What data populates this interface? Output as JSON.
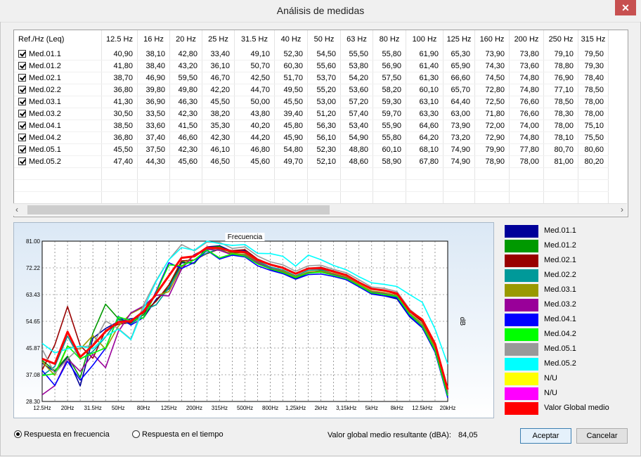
{
  "window": {
    "title": "Análisis de medidas",
    "close": "✕"
  },
  "table": {
    "headers": [
      "Ref./Hz (Leq)",
      "12.5 Hz",
      "16 Hz",
      "20 Hz",
      "25 Hz",
      "31.5 Hz",
      "40 Hz",
      "50 Hz",
      "63 Hz",
      "80 Hz",
      "100 Hz",
      "125 Hz",
      "160 Hz",
      "200 Hz",
      "250 Hz",
      "315 Hz"
    ],
    "rows": [
      {
        "ref": "Med.01.1",
        "values": [
          "40,90",
          "38,10",
          "42,80",
          "33,40",
          "49,10",
          "52,30",
          "54,50",
          "55,50",
          "55,80",
          "61,90",
          "65,30",
          "73,90",
          "73,80",
          "79,10",
          "79,50"
        ]
      },
      {
        "ref": "Med.01.2",
        "values": [
          "41,80",
          "38,40",
          "43,20",
          "36,10",
          "50,70",
          "60,30",
          "55,60",
          "53,80",
          "56,90",
          "61,40",
          "65,90",
          "74,30",
          "73,60",
          "78,80",
          "79,30"
        ]
      },
      {
        "ref": "Med.02.1",
        "values": [
          "38,70",
          "46,90",
          "59,50",
          "46,70",
          "42,50",
          "51,70",
          "53,70",
          "54,20",
          "57,50",
          "61,30",
          "66,60",
          "74,50",
          "74,80",
          "76,90",
          "78,40"
        ]
      },
      {
        "ref": "Med.02.2",
        "values": [
          "36,80",
          "39,80",
          "49,80",
          "42,20",
          "44,70",
          "49,50",
          "55,20",
          "53,60",
          "58,20",
          "60,10",
          "65,70",
          "72,80",
          "74,80",
          "77,10",
          "78,50"
        ]
      },
      {
        "ref": "Med.03.1",
        "values": [
          "41,30",
          "36,90",
          "46,30",
          "45,50",
          "50,00",
          "45,50",
          "53,00",
          "57,20",
          "59,30",
          "63,10",
          "64,40",
          "72,50",
          "76,60",
          "78,50",
          "78,00"
        ]
      },
      {
        "ref": "Med.03.2",
        "values": [
          "30,50",
          "33,50",
          "42,30",
          "38,20",
          "43,80",
          "39,40",
          "51,20",
          "57,40",
          "59,70",
          "63,30",
          "63,00",
          "71,80",
          "76,60",
          "78,30",
          "78,00"
        ]
      },
      {
        "ref": "Med.04.1",
        "values": [
          "38,50",
          "33,60",
          "41,50",
          "35,30",
          "40,20",
          "45,80",
          "56,30",
          "53,40",
          "55,90",
          "64,60",
          "73,90",
          "72,00",
          "74,00",
          "78,00",
          "75,10"
        ]
      },
      {
        "ref": "Med.04.2",
        "values": [
          "36,80",
          "37,40",
          "46,60",
          "42,30",
          "44,20",
          "45,90",
          "56,10",
          "54,90",
          "55,80",
          "64,20",
          "73,20",
          "72,90",
          "74,80",
          "78,10",
          "75,50"
        ]
      },
      {
        "ref": "Med.05.1",
        "values": [
          "45,50",
          "37,50",
          "42,30",
          "46,10",
          "46,80",
          "54,80",
          "52,30",
          "48,80",
          "60,10",
          "68,10",
          "74,90",
          "79,90",
          "77,80",
          "80,70",
          "80,60"
        ]
      },
      {
        "ref": "Med.05.2",
        "values": [
          "47,40",
          "44,30",
          "45,60",
          "46,50",
          "45,60",
          "49,70",
          "52,10",
          "48,60",
          "58,90",
          "67,80",
          "74,90",
          "78,90",
          "78,00",
          "81,00",
          "80,20"
        ]
      }
    ]
  },
  "chart_data": {
    "type": "line",
    "title": "Frecuencia",
    "ylabel": "dB",
    "ylim": [
      28.3,
      81.0
    ],
    "y_ticks": [
      "81.00",
      "72.22",
      "63.43",
      "54.65",
      "45.87",
      "37.08",
      "28.30"
    ],
    "x_tick_labels": [
      "12.5Hz",
      "20Hz",
      "31.5Hz",
      "50Hz",
      "80Hz",
      "125Hz",
      "200Hz",
      "315Hz",
      "500Hz",
      "800Hz",
      "1,25kHz",
      "2kHz",
      "3,15kHz",
      "5kHz",
      "8kHz",
      "12.5kHz",
      "20kHz"
    ],
    "x": [
      "12.5",
      "16",
      "20",
      "25",
      "31.5",
      "40",
      "50",
      "63",
      "80",
      "100",
      "125",
      "160",
      "200",
      "250",
      "315",
      "400",
      "500",
      "630",
      "800",
      "1k",
      "1.25k",
      "1.6k",
      "2k",
      "2.5k",
      "3.15k",
      "4k",
      "5k",
      "6.3k",
      "8k",
      "10k",
      "12.5k",
      "16k",
      "20k"
    ],
    "series": [
      {
        "name": "Med.01.1",
        "color": "#000099",
        "values": [
          40.9,
          38.1,
          42.8,
          33.4,
          49.1,
          52.3,
          54.5,
          55.5,
          55.8,
          61.9,
          65.3,
          73.9,
          73.8,
          79.1,
          79.5,
          77.6,
          77.8,
          74.0,
          71.8,
          70.6,
          68.6,
          70.5,
          71.2,
          69.9,
          68.8,
          66.1,
          63.8,
          63.0,
          62.0,
          56.1,
          52.5,
          44.5,
          30.1
        ]
      },
      {
        "name": "Med.01.2",
        "color": "#009900",
        "values": [
          41.8,
          38.4,
          43.2,
          36.1,
          50.7,
          60.3,
          55.6,
          53.8,
          56.9,
          61.4,
          65.9,
          74.3,
          73.6,
          78.8,
          79.3,
          77.0,
          77.5,
          73.8,
          72.0,
          70.9,
          68.9,
          70.7,
          71.3,
          70.1,
          68.9,
          66.3,
          64.2,
          63.4,
          62.3,
          56.8,
          53.0,
          45.0,
          30.5
        ]
      },
      {
        "name": "Med.02.1",
        "color": "#990000",
        "values": [
          38.7,
          46.9,
          59.5,
          46.7,
          42.5,
          51.7,
          53.7,
          54.2,
          57.5,
          61.3,
          66.6,
          74.5,
          74.8,
          76.9,
          78.4,
          77.9,
          78.2,
          75.1,
          73.4,
          72.4,
          70.4,
          72.1,
          72.4,
          71.2,
          70.0,
          67.5,
          65.3,
          64.7,
          63.5,
          57.8,
          54.5,
          46.0,
          31.0
        ]
      },
      {
        "name": "Med.02.2",
        "color": "#009999",
        "values": [
          36.8,
          39.8,
          49.8,
          42.2,
          44.7,
          49.5,
          55.2,
          53.6,
          58.2,
          60.1,
          65.7,
          72.8,
          74.8,
          77.1,
          78.5,
          76.5,
          76.8,
          74.4,
          72.5,
          71.5,
          69.6,
          71.4,
          71.6,
          70.3,
          69.0,
          66.6,
          64.5,
          63.6,
          62.6,
          56.7,
          53.0,
          45.5,
          30.8
        ]
      },
      {
        "name": "Med.03.1",
        "color": "#999900",
        "values": [
          41.3,
          36.9,
          46.3,
          45.5,
          50.0,
          45.5,
          53.0,
          57.2,
          59.3,
          63.1,
          64.4,
          72.5,
          76.6,
          78.5,
          78.0,
          76.9,
          76.7,
          74.1,
          72.0,
          71.2,
          69.3,
          70.9,
          71.1,
          70.4,
          69.2,
          66.8,
          64.6,
          64.1,
          63.1,
          57.2,
          53.9,
          46.0,
          31.5
        ]
      },
      {
        "name": "Med.03.2",
        "color": "#990099",
        "values": [
          30.5,
          33.5,
          42.3,
          38.2,
          43.8,
          39.4,
          51.2,
          57.4,
          59.7,
          63.3,
          63.0,
          71.8,
          76.6,
          78.3,
          78.0,
          76.5,
          76.3,
          73.9,
          72.1,
          70.8,
          69.0,
          70.6,
          70.8,
          70.0,
          68.9,
          66.4,
          64.1,
          63.7,
          62.8,
          56.9,
          53.3,
          45.2,
          30.9
        ]
      },
      {
        "name": "Med.04.1",
        "color": "#0000ff",
        "values": [
          38.5,
          33.6,
          41.5,
          35.3,
          40.2,
          45.8,
          56.3,
          53.4,
          55.9,
          64.6,
          73.9,
          72.0,
          74.0,
          78.0,
          75.1,
          76.4,
          75.8,
          72.9,
          71.4,
          70.3,
          68.5,
          70.0,
          70.2,
          69.4,
          68.3,
          66.0,
          63.6,
          63.0,
          62.4,
          56.3,
          52.6,
          44.7,
          29.5
        ]
      },
      {
        "name": "Med.04.2",
        "color": "#00ff00",
        "values": [
          36.8,
          37.4,
          46.6,
          42.3,
          44.2,
          45.9,
          56.1,
          54.9,
          55.8,
          64.2,
          73.2,
          72.9,
          74.8,
          78.1,
          75.5,
          76.8,
          76.1,
          73.5,
          71.9,
          70.7,
          69.0,
          70.5,
          70.8,
          69.8,
          68.7,
          66.4,
          64.0,
          63.5,
          62.8,
          56.9,
          53.1,
          45.1,
          30.2
        ]
      },
      {
        "name": "Med.05.1",
        "color": "#999999",
        "values": [
          45.5,
          37.5,
          42.3,
          46.1,
          46.8,
          54.8,
          52.3,
          48.8,
          60.1,
          68.1,
          74.9,
          79.9,
          77.8,
          80.7,
          80.6,
          78.6,
          79.1,
          76.1,
          74.2,
          73.2,
          71.1,
          72.9,
          73.1,
          71.7,
          70.6,
          68.3,
          65.9,
          65.5,
          64.4,
          58.6,
          55.1,
          47.1,
          32.0
        ]
      },
      {
        "name": "Med.05.2",
        "color": "#00ffff",
        "values": [
          47.4,
          44.3,
          45.6,
          46.5,
          45.6,
          49.7,
          52.1,
          48.6,
          58.9,
          67.8,
          74.9,
          78.9,
          78.0,
          81.0,
          80.2,
          79.6,
          79.9,
          77.0,
          76.9,
          76.0,
          72.8,
          76.4,
          74.9,
          73.0,
          71.6,
          69.3,
          67.3,
          66.8,
          66.1,
          63.4,
          60.9,
          52.1,
          40.6
        ]
      },
      {
        "name": "Valor Global medio",
        "color": "#ff0000",
        "values": [
          42.3,
          40.7,
          51.2,
          42.9,
          46.7,
          51.3,
          54.4,
          54.7,
          57.9,
          63.7,
          69.6,
          75.5,
          76.0,
          78.9,
          78.7,
          77.6,
          77.4,
          74.8,
          73.3,
          72.2,
          70.3,
          72.0,
          72.1,
          71.0,
          69.8,
          67.4,
          65.3,
          64.8,
          63.8,
          58.1,
          55.2,
          47.2,
          32.2
        ]
      }
    ],
    "legend": [
      {
        "label": "Med.01.1",
        "color": "#000099"
      },
      {
        "label": "Med.01.2",
        "color": "#009900"
      },
      {
        "label": "Med.02.1",
        "color": "#990000"
      },
      {
        "label": "Med.02.2",
        "color": "#009999"
      },
      {
        "label": "Med.03.1",
        "color": "#999900"
      },
      {
        "label": "Med.03.2",
        "color": "#990099"
      },
      {
        "label": "Med.04.1",
        "color": "#0000ff"
      },
      {
        "label": "Med.04.2",
        "color": "#00ff00"
      },
      {
        "label": "Med.05.1",
        "color": "#999999"
      },
      {
        "label": "Med.05.2",
        "color": "#00ffff"
      },
      {
        "label": "N/U",
        "color": "#ffff00"
      },
      {
        "label": "N/U",
        "color": "#ff00ff"
      },
      {
        "label": "Valor Global medio",
        "color": "#ff0000"
      }
    ]
  },
  "controls": {
    "radio_freq": "Respuesta en frecuencia",
    "radio_time": "Respuesta en el tiempo",
    "global_label": "Valor global medio resultante (dBA):",
    "global_value": "84,05",
    "accept": "Aceptar",
    "cancel": "Cancelar"
  }
}
